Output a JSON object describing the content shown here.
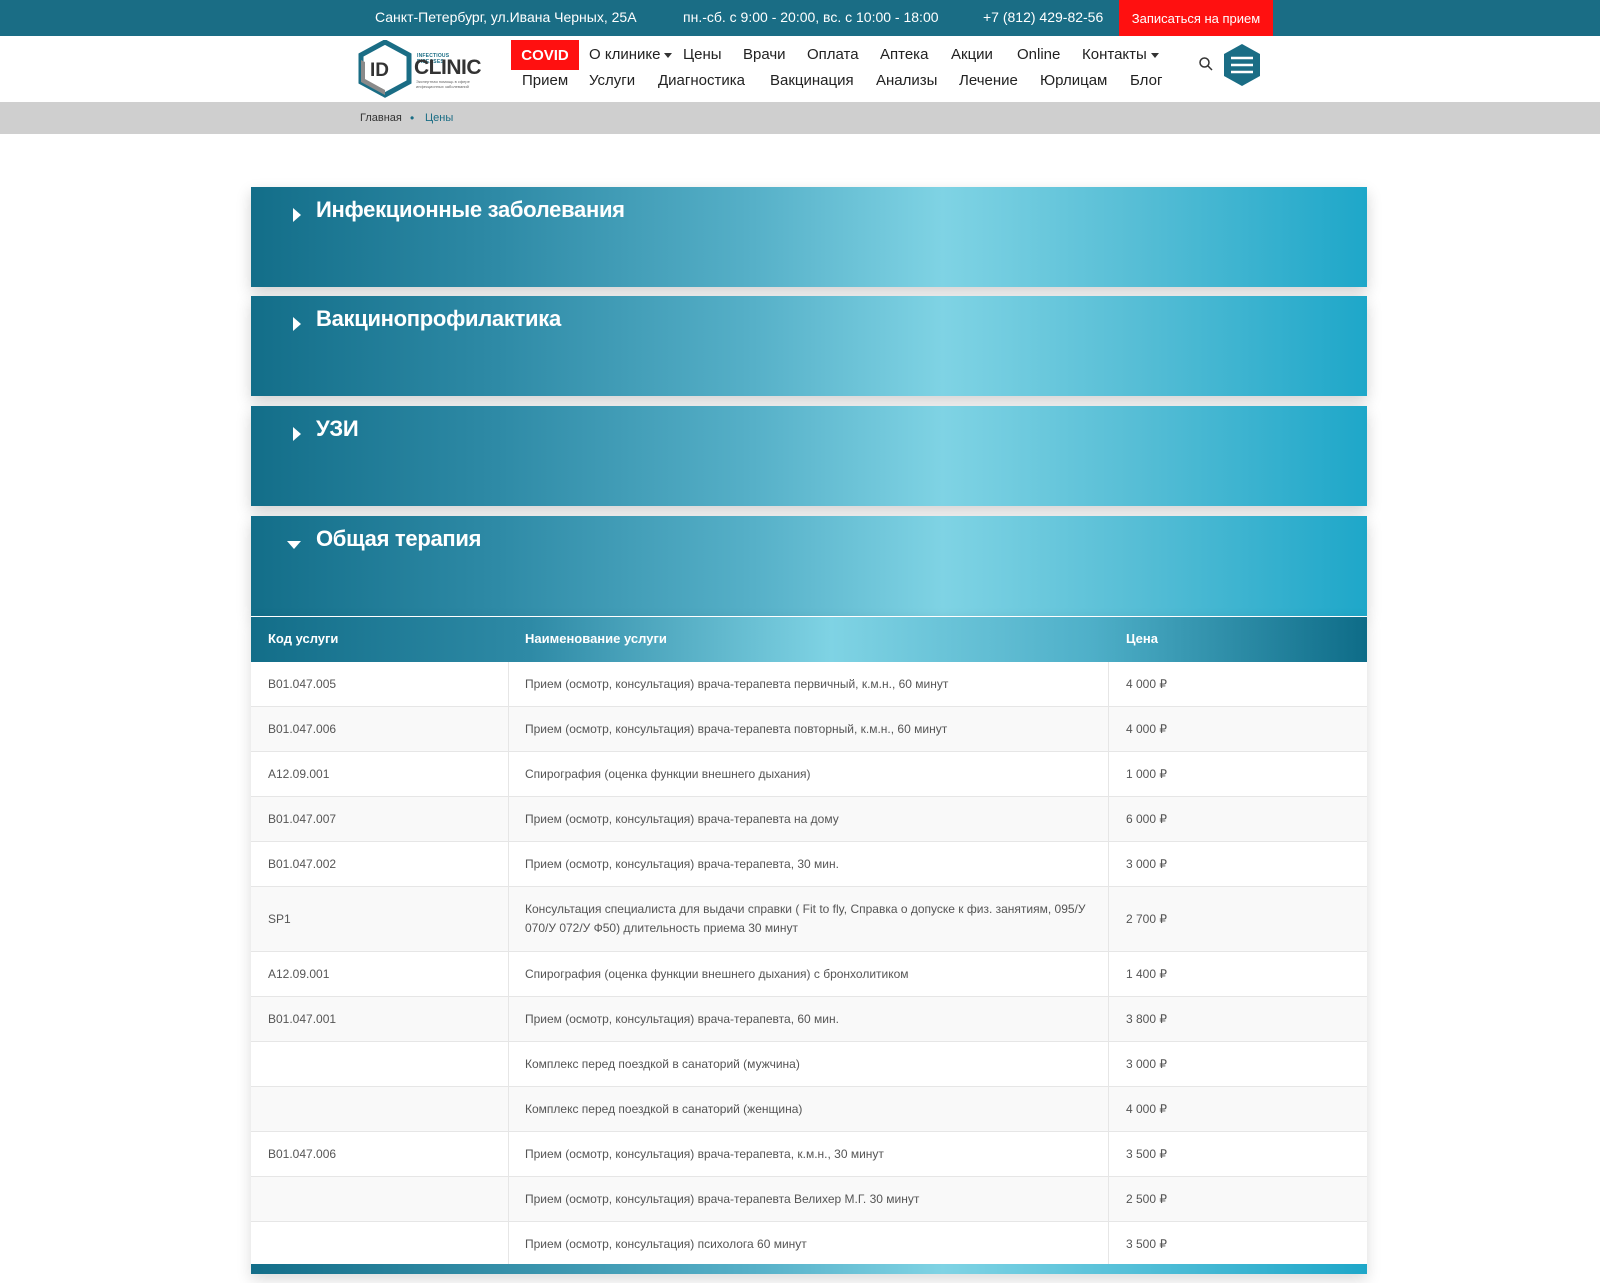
{
  "topbar": {
    "address": "Санкт-Петербург, ул.Ивана Черных, 25А",
    "hours": "пн.-сб. с 9:00 - 20:00, вс. с 10:00 - 18:00",
    "phone": "+7 (812) 429-82-56",
    "book_label": "Записаться на прием"
  },
  "logo": {
    "main": "CLINIC",
    "badge": "ID",
    "sub_top": "INFECTIOUS DISEASES",
    "sub_bottom": "Экспертная помощь в сфере инфекционных заболеваний"
  },
  "nav": {
    "covid": "COVID",
    "row1": [
      "О клинике",
      "Цены",
      "Врачи",
      "Оплата",
      "Аптека",
      "Акции",
      "Online",
      "Контакты"
    ],
    "row2": [
      "Прием",
      "Услуги",
      "Диагностика",
      "Вакцинация",
      "Анализы",
      "Лечение",
      "Юрлицам",
      "Блог"
    ]
  },
  "breadcrumb": {
    "home": "Главная",
    "separator": "•",
    "current": "Цены"
  },
  "accordions": [
    {
      "label": "Инфекционные заболевания",
      "expanded": false
    },
    {
      "label": "Вакцинопрофилактика",
      "expanded": false
    },
    {
      "label": "УЗИ",
      "expanded": false
    },
    {
      "label": "Общая терапия",
      "expanded": true
    }
  ],
  "table": {
    "headers": [
      "Код услуги",
      "Наименование услуги",
      "Цена"
    ],
    "rows": [
      {
        "code": "B01.047.005",
        "name": "Прием (осмотр, консультация) врача-терапевта первичный, к.м.н., 60 минут",
        "price": "4 000 ₽"
      },
      {
        "code": "B01.047.006",
        "name": "Прием (осмотр, консультация) врача-терапевта повторный, к.м.н., 60 минут",
        "price": "4 000 ₽"
      },
      {
        "code": "A12.09.001",
        "name": "Спирография (оценка функции внешнего дыхания)",
        "price": "1 000 ₽"
      },
      {
        "code": "B01.047.007",
        "name": "Прием (осмотр, консультация) врача-терапевта на дому",
        "price": "6 000 ₽"
      },
      {
        "code": "B01.047.002",
        "name": "Прием (осмотр, консультация) врача-терапевта, 30 мин.",
        "price": "3 000 ₽"
      },
      {
        "code": "SP1",
        "name": "Консультация специалиста для выдачи справки ( Fit to fly, Справка о допуске к физ. занятиям, 095/У 070/У 072/У Ф50) длительность приема 30 минут",
        "price": "2 700 ₽"
      },
      {
        "code": "A12.09.001",
        "name": "Спирография (оценка функции внешнего дыхания) с бронхолитиком",
        "price": "1 400 ₽"
      },
      {
        "code": "B01.047.001",
        "name": "Прием (осмотр, консультация) врача-терапевта, 60 мин.",
        "price": "3 800 ₽"
      },
      {
        "code": "",
        "name": "Комплекс перед поездкой в санаторий (мужчина)",
        "price": "3 000 ₽"
      },
      {
        "code": "",
        "name": "Комплекс перед поездкой в санаторий (женщина)",
        "price": "4 000 ₽"
      },
      {
        "code": "B01.047.006",
        "name": "Прием (осмотр, консультация) врача-терапевта, к.м.н., 30 минут",
        "price": "3 500 ₽"
      },
      {
        "code": "",
        "name": "Прием (осмотр, консультация) врача-терапевта Велихер М.Г. 30 минут",
        "price": "2 500 ₽"
      },
      {
        "code": "",
        "name": "Прием (осмотр, консультация) психолога 60 минут",
        "price": "3 500 ₽"
      }
    ]
  },
  "colors": {
    "brand": "#1a6d85",
    "accent_red": "#ff1010",
    "gradient_light": "#7fd3e4"
  }
}
